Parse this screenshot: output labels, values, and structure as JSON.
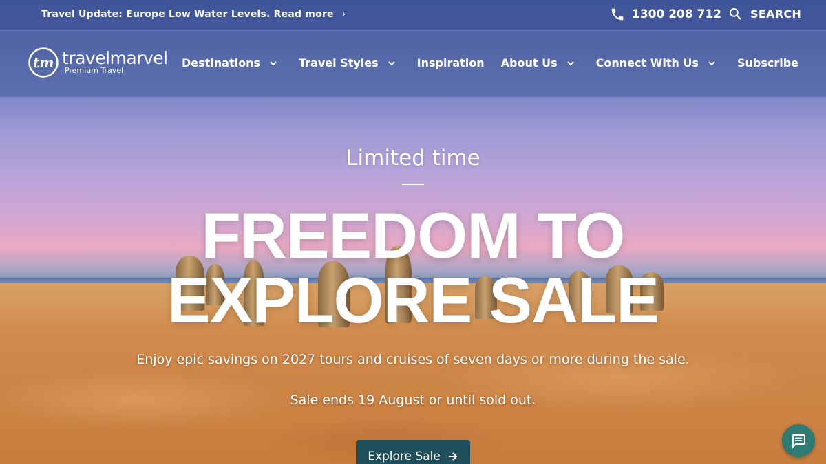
{
  "topbar": {
    "update_text": "Travel Update: Europe Low Water Levels. Read more",
    "phone_number": "1300 208 712",
    "search_label": "SEARCH"
  },
  "logo": {
    "name": "travelmarvel",
    "tagline": "Premium Travel"
  },
  "nav": {
    "items": [
      {
        "label": "Destinations",
        "has_dropdown": true
      },
      {
        "label": "Travel Styles",
        "has_dropdown": true
      },
      {
        "label": "Inspiration",
        "has_dropdown": false
      },
      {
        "label": "About Us",
        "has_dropdown": true
      },
      {
        "label": "Connect With Us",
        "has_dropdown": true
      },
      {
        "label": "Subscribe",
        "has_dropdown": false
      }
    ]
  },
  "hero": {
    "kicker": "Limited time",
    "headline_line1": "FREEDOM TO",
    "headline_line2": "EXPLORE SALE",
    "description": "Enjoy epic savings on 2027 tours and cruises of seven days or more during the sale.",
    "sale_ends": "Sale ends 19 August or until sold out.",
    "cta_label": "Explore Sale"
  },
  "colors": {
    "cta_background": "#1f4f5c",
    "chat_background": "#2f7a73",
    "header_background": "#3b5196"
  },
  "icons": {
    "phone": "phone-icon",
    "search": "search-icon",
    "chat": "chat-icon",
    "arrow": "arrow-right-icon"
  }
}
